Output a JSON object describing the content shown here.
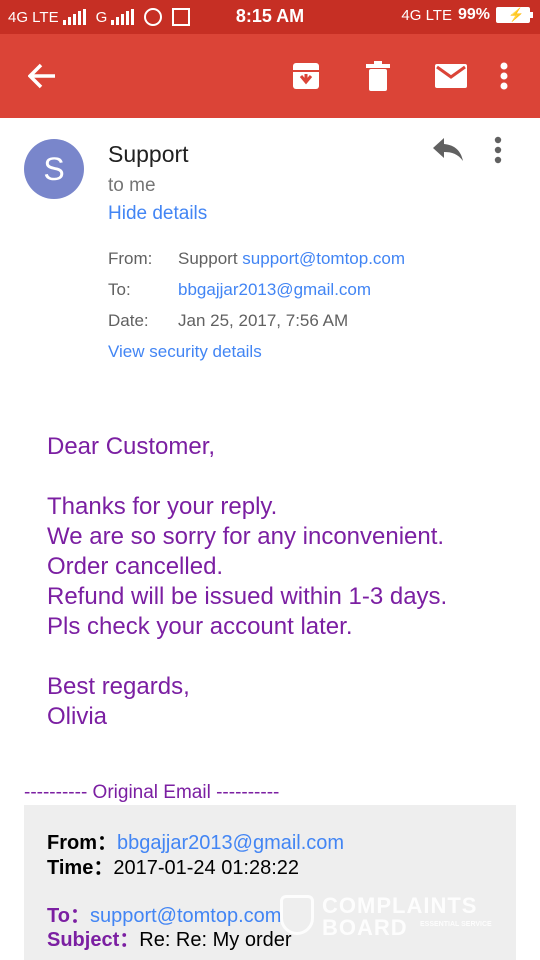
{
  "status_bar": {
    "network1": "4G LTE",
    "network2": "G",
    "time": "8:15 AM",
    "network3": "4G LTE",
    "battery": "99%"
  },
  "header": {
    "avatar_letter": "S",
    "sender_name": "Support",
    "recipient": "to me",
    "hide_details": "Hide details"
  },
  "details": {
    "from_label": "From:",
    "from_name": "Support",
    "from_email": "support@tomtop.com",
    "to_label": "To:",
    "to_email": "bbgajjar2013@gmail.com",
    "date_label": "Date:",
    "date_value": "Jan 25, 2017, 7:56 AM",
    "security_link": "View security details"
  },
  "message": {
    "greeting": "Dear Customer,",
    "line1": "Thanks for your reply.",
    "line2": "We are so sorry for any inconvenient.",
    "line3": "Order cancelled.",
    "line4": "Refund will be issued within 1-3 days.",
    "line5": "Pls check your account later.",
    "closing": "Best regards,",
    "signature": "Olivia"
  },
  "original": {
    "separator": "---------- Original Email ----------",
    "from_label": "From：",
    "from_value": "bbgajjar2013@gmail.com",
    "time_label": "Time：",
    "time_value": "2017-01-24 01:28:22",
    "to_label": "To：",
    "to_value": "support@tomtop.com",
    "subject_label": "Subject：",
    "subject_value": "Re: Re: My order"
  },
  "watermark": {
    "line1": "COMPLAINTS",
    "line2": "BOARD",
    "tagline": "ESSENTIAL SERVICE"
  },
  "colors": {
    "status_bar": "#c62f24",
    "app_bar": "#db4437",
    "link": "#4285f4",
    "message_text": "#7b1fa2",
    "avatar": "#7986cb"
  }
}
